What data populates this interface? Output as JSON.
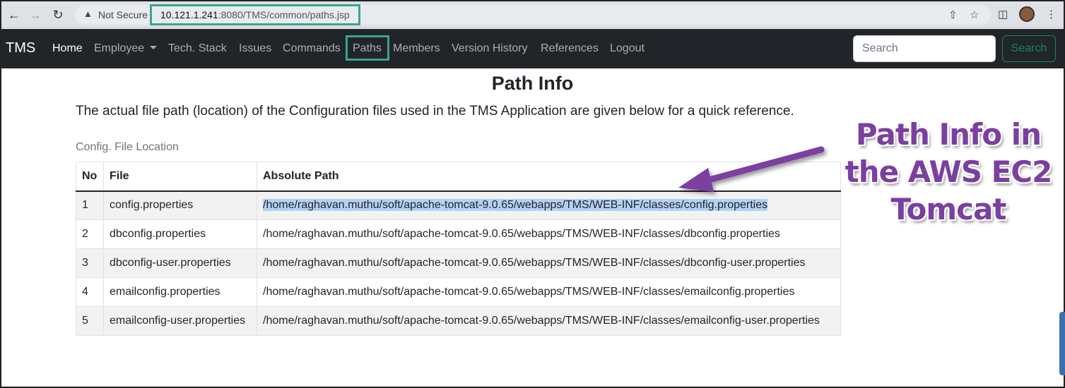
{
  "browser": {
    "security_label": "Not Secure",
    "url_host": "10.121.1.241",
    "url_rest": ":8080/TMS/common/paths.jsp"
  },
  "navbar": {
    "brand": "TMS",
    "items": [
      {
        "label": "Home",
        "active": true
      },
      {
        "label": "Employee",
        "dropdown": true
      },
      {
        "label": "Tech. Stack"
      },
      {
        "label": "Issues"
      },
      {
        "label": "Commands"
      },
      {
        "label": "Paths"
      },
      {
        "label": "Members"
      },
      {
        "label": "Version History"
      },
      {
        "label": "References"
      },
      {
        "label": "Logout"
      }
    ],
    "search_placeholder": "Search",
    "search_button": "Search"
  },
  "page": {
    "title": "Path Info",
    "lead": "The actual file path (location) of the Configuration files used in the TMS Application are given below for a quick reference.",
    "table_caption": "Config. File Location",
    "columns": [
      "No",
      "File",
      "Absolute Path"
    ],
    "rows": [
      {
        "no": "1",
        "file": "config.properties",
        "path": "/home/raghavan.muthu/soft/apache-tomcat-9.0.65/webapps/TMS/WEB-INF/classes/config.properties"
      },
      {
        "no": "2",
        "file": "dbconfig.properties",
        "path": "/home/raghavan.muthu/soft/apache-tomcat-9.0.65/webapps/TMS/WEB-INF/classes/dbconfig.properties"
      },
      {
        "no": "3",
        "file": "dbconfig-user.properties",
        "path": "/home/raghavan.muthu/soft/apache-tomcat-9.0.65/webapps/TMS/WEB-INF/classes/dbconfig-user.properties"
      },
      {
        "no": "4",
        "file": "emailconfig.properties",
        "path": "/home/raghavan.muthu/soft/apache-tomcat-9.0.65/webapps/TMS/WEB-INF/classes/emailconfig.properties"
      },
      {
        "no": "5",
        "file": "emailconfig-user.properties",
        "path": "/home/raghavan.muthu/soft/apache-tomcat-9.0.65/webapps/TMS/WEB-INF/classes/emailconfig-user.properties"
      }
    ]
  },
  "annotation": {
    "lines": [
      "Path Info in",
      "the AWS EC2",
      "Tomcat"
    ],
    "color": "#7b3fa0"
  },
  "colors": {
    "highlight_box": "#3aa58d",
    "navbar_bg": "#212529",
    "search_button": "#198754",
    "selection": "#b3d1f5"
  },
  "icons": [
    "back-arrow-icon",
    "forward-arrow-icon",
    "reload-icon",
    "warning-icon",
    "share-icon",
    "star-icon",
    "sidebar-icon",
    "avatar",
    "kebab-menu-icon",
    "dropdown-caret-icon"
  ]
}
